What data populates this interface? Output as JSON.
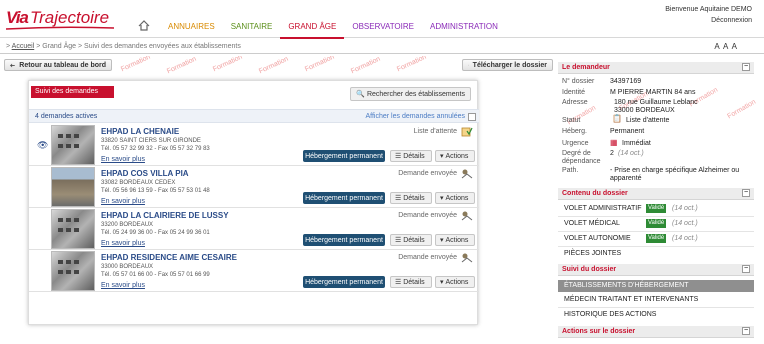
{
  "app": {
    "logo_prefix": "Via",
    "logo_main": "Trajectoire"
  },
  "nav": {
    "items": [
      {
        "label": "ANNUAIRES"
      },
      {
        "label": "SANITAIRE"
      },
      {
        "label": "GRAND ÂGE"
      },
      {
        "label": "OBSERVATOIRE"
      },
      {
        "label": "ADMINISTRATION"
      }
    ]
  },
  "user": {
    "welcome": "Bienvenue Aquitaine DEMO",
    "logout": "Déconnexion"
  },
  "breadcrumb": {
    "sep": ">",
    "link": "Accueil",
    "rest": "> Grand Âge > Suivi des demandes envoyées aux établissements"
  },
  "font_controls": "A A A",
  "toolbar": {
    "back_label": "Retour au tableau de bord",
    "download_label": "Télécharger le dossier",
    "watermark": "Formation"
  },
  "panel": {
    "tab_label": "Suivi des demandes",
    "search_label": "Rechercher des établissements",
    "count_label": "4 demandes actives",
    "show_cancelled": "Afficher les demandes annulées",
    "more_label": "En savoir plus",
    "hp_label": "Hébergement permanent",
    "details_label": "Détails",
    "actions_label": "Actions"
  },
  "ehpads": [
    {
      "name": "EHPAD LA CHENAIE",
      "addr1": "33820 SAINT CIERS SUR GIRONDE",
      "phone": "Tél. 05 57 32 99 32 - Fax 05 57 32 79 83",
      "status": "Liste d'attente"
    },
    {
      "name": "EHPAD COS VILLA PIA",
      "addr1": "33082 BORDEAUX CEDEX",
      "phone": "Tél. 05 56 96 13 59 - Fax 05 57 53 01 48",
      "status": "Demande envoyée"
    },
    {
      "name": "EHPAD LA CLAIRIERE DE LUSSY",
      "addr1": "33200 BORDEAUX",
      "phone": "Tél. 05 24 99 36 00 - Fax 05 24 99 36 01",
      "status": "Demande envoyée"
    },
    {
      "name": "EHPAD RESIDENCE AIME CESAIRE",
      "addr1": "33000 BORDEAUX",
      "phone": "Tél. 05 57 01 66 00 - Fax 05 57 01 66 99",
      "status": "Demande envoyée"
    }
  ],
  "demandeur": {
    "title": "Le demandeur",
    "rows": [
      {
        "label": "N° dossier",
        "value": "34397169"
      },
      {
        "label": "Identité",
        "value": "M PIERRE MARTIN 84 ans"
      },
      {
        "label": "Adresse",
        "value": "180 rue Guillaume Leblanc",
        "value2": "33000 BORDEAUX"
      },
      {
        "label": "Statut",
        "value": "Liste d'attente"
      },
      {
        "label": "Héberg.",
        "value": "Permanent"
      },
      {
        "label": "Urgence",
        "value": "Immédiat"
      },
      {
        "label": "Degré de dépendance",
        "value": "2",
        "value_note": "(14 oct.)"
      },
      {
        "label": "Path.",
        "value": "- Prise en charge spécifique Alzheimer ou",
        "value2": "apparenté"
      }
    ]
  },
  "contenu": {
    "title": "Contenu du dossier",
    "volets": [
      {
        "label": "VOLET ADMINISTRATIF",
        "state": "Validé",
        "date": "(14 oct.)"
      },
      {
        "label": "VOLET MÉDICAL",
        "state": "Validé",
        "date": "(14 oct.)"
      },
      {
        "label": "VOLET AUTONOMIE",
        "state": "Validé",
        "date": "(14 oct.)"
      },
      {
        "label": "PIÈCES JOINTES"
      }
    ]
  },
  "suivi": {
    "title": "Suivi du dossier",
    "items": [
      {
        "label": "ÉTABLISSEMENTS D'HÉBERGEMENT"
      },
      {
        "label": "MÉDECIN TRAITANT ET INTERVENANTS"
      },
      {
        "label": "HISTORIQUE DES ACTIONS"
      }
    ]
  },
  "actions_dossier": {
    "title": "Actions sur le dossier"
  }
}
